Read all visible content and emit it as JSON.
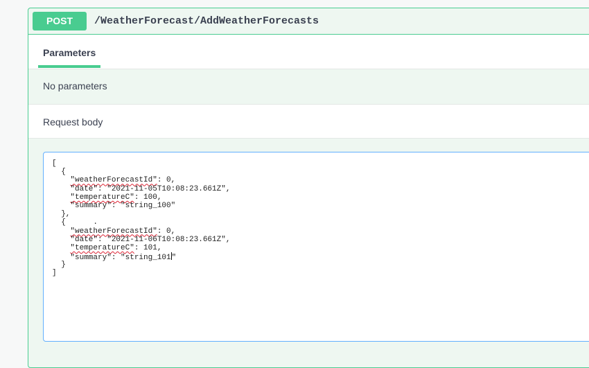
{
  "operation": {
    "method": "POST",
    "path": "/WeatherForecast/AddWeatherForecasts"
  },
  "parameters": {
    "tab_label": "Parameters",
    "empty_message": "No parameters"
  },
  "request_body": {
    "label": "Request body",
    "lines": {
      "l1": "[",
      "l2": "  {",
      "l3_key": "\"weatherForecastId\"",
      "l3_val": ": 0,",
      "l4": "    \"date\": \"2021-11-05T10:08:23.661Z\",",
      "l5_key": "\"temperatureC\"",
      "l5_val": ": 100,",
      "l6": "    \"summary\": \"string_100\"",
      "l7": "  },",
      "l8": "  {      .",
      "l9_key": "\"weatherForecastId\"",
      "l9_val": ": 0,",
      "l10": "    \"date\": \"2021-11-06T10:08:23.661Z\",",
      "l11_key": "\"temperatureC\"",
      "l11_val": ": 101,",
      "l12_a": "    \"summary\": \"string_101",
      "l12_b": "\"",
      "l13": "  }",
      "l14": "]"
    }
  },
  "colors": {
    "post_green": "#49cc90",
    "editor_border": "#61affe",
    "block_bg": "#eef7f1"
  }
}
